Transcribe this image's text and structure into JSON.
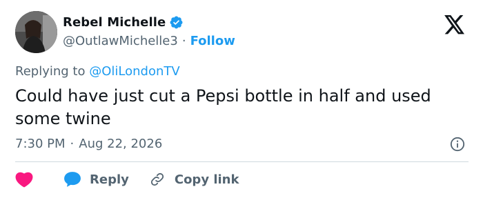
{
  "author": {
    "display_name": "Rebel Michelle",
    "handle": "@OutlawMichelle3",
    "separator": "·",
    "follow_label": "Follow",
    "verified": true
  },
  "tweet": {
    "replying_prefix": "Replying to",
    "replying_to": "@OliLondonTV",
    "text": "Could have just cut a Pepsi bottle in half and used some twine",
    "time": "7:30 PM",
    "date_separator": "·",
    "date": "Aug 22, 2026"
  },
  "actions": {
    "reply_label": "Reply",
    "copy_link_label": "Copy link"
  },
  "colors": {
    "accent": "#1d9bf0",
    "like": "#f91880",
    "text": "#0f1419",
    "secondary": "#536471",
    "divider": "#cfd9de"
  },
  "icons": [
    "verified-badge-icon",
    "x-logo-icon",
    "info-icon",
    "heart-icon",
    "reply-bubble-icon",
    "link-icon"
  ]
}
